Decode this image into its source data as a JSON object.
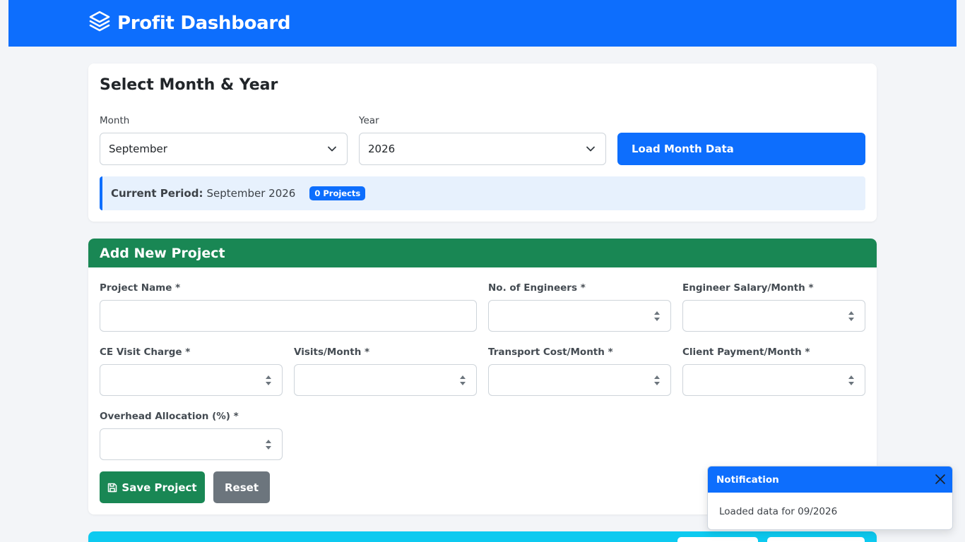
{
  "navbar": {
    "brand": "Profit Dashboard",
    "brand_icon": "layers-icon"
  },
  "period_card": {
    "title": "Select Month & Year",
    "month_label": "Month",
    "month_value": "September",
    "year_label": "Year",
    "year_value": "2026",
    "load_button": "Load Month Data",
    "current_period_key": "Current Period:",
    "current_period_value": "September 2026",
    "projects_badge": "0 Projects"
  },
  "project_form": {
    "title": "Add New Project",
    "fields": {
      "project_name": "Project Name *",
      "engineers": "No. of Engineers *",
      "salary": "Engineer Salary/Month *",
      "ce_visit": "CE Visit Charge *",
      "visits": "Visits/Month *",
      "transport": "Transport Cost/Month *",
      "client_payment": "Client Payment/Month *",
      "overhead": "Overhead Allocation (%) *"
    },
    "save_button": "Save Project",
    "reset_button": "Reset"
  },
  "toast": {
    "title": "Notification",
    "message": "Loaded data for 09/2026"
  },
  "colors": {
    "primary": "#0d6efd",
    "success": "#198754",
    "secondary": "#6c757d",
    "info": "#0dcaf0",
    "background": "#f3f5f8"
  }
}
